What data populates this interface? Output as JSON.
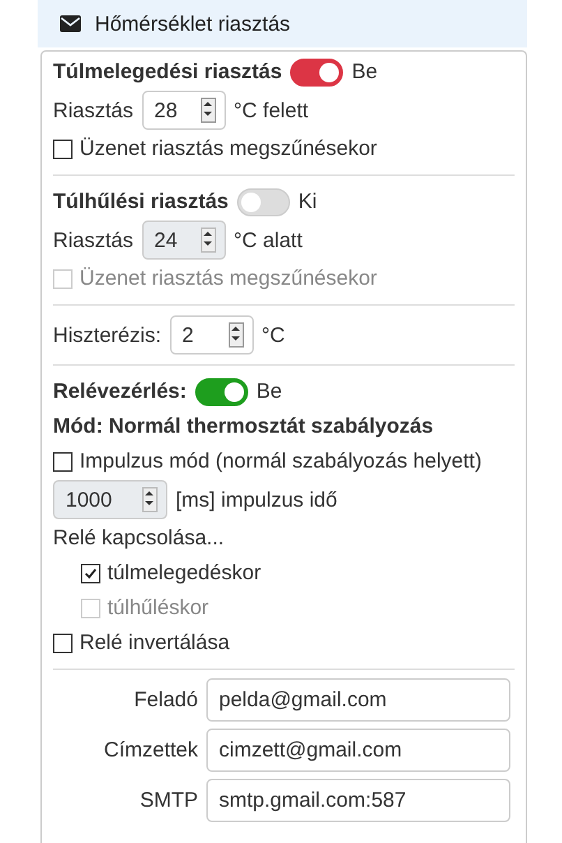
{
  "header": {
    "title": "Hőmérséklet riasztás"
  },
  "alarms": [
    {
      "title": "Túlmelegedési riasztás",
      "on": true,
      "color": "#dc3545",
      "state_label": "Be",
      "label": "Riasztás",
      "value": "28",
      "unit": "°C felett",
      "disabled": false,
      "message": {
        "label": "Üzenet riasztás megszűnésekor",
        "checked": false,
        "disabled": false
      }
    },
    {
      "title": "Túlhűlési riasztás",
      "on": false,
      "state_label": "Ki",
      "label": "Riasztás",
      "value": "24",
      "unit": "°C alatt",
      "disabled": true,
      "message": {
        "label": "Üzenet riasztás megszűnésekor",
        "checked": false,
        "disabled": true
      }
    }
  ],
  "hysteresis": {
    "label": "Hiszterézis:",
    "value": "2",
    "unit": "°C",
    "disabled": false
  },
  "relay": {
    "title": "Relévezérlés:",
    "on": true,
    "color": "#1e9e1e",
    "state_label": "Be",
    "mode": "Mód: Normál thermosztát szabályozás",
    "impulse": {
      "label": "Impulzus mód (normál szabályozás helyett)",
      "checked": false,
      "disabled": false
    },
    "impulse_time": {
      "value": "1000",
      "unit": "[ms] impulzus idő",
      "disabled": true
    },
    "switching_label": "Relé kapcsolása...",
    "switching": [
      {
        "label": "túlmelegedéskor",
        "checked": true,
        "disabled": false
      },
      {
        "label": "túlhűléskor",
        "checked": false,
        "disabled": true
      }
    ],
    "invert": {
      "label": "Relé invertálása",
      "checked": false,
      "disabled": false
    }
  },
  "email": [
    {
      "label": "Feladó",
      "value": "pelda@gmail.com"
    },
    {
      "label": "Címzettek",
      "value": "cimzett@gmail.com"
    },
    {
      "label": "SMTP",
      "value": "smtp.gmail.com:587"
    }
  ]
}
